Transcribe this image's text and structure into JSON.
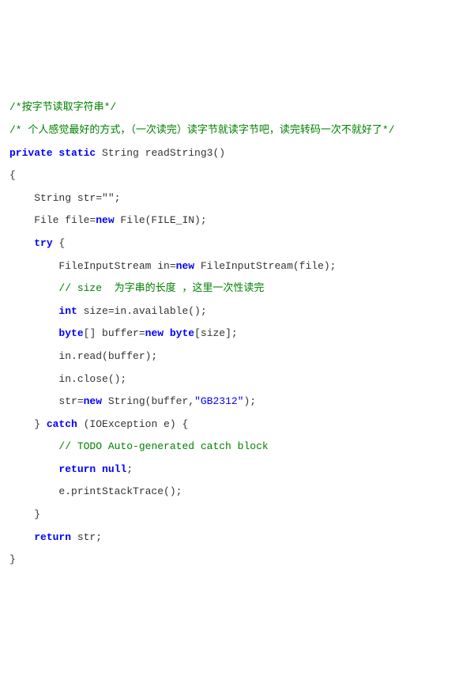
{
  "code": {
    "lines": [
      {
        "type": "comment",
        "text": "/*按字节读取字符串*/"
      },
      {
        "type": "comment",
        "text": "/* 个人感觉最好的方式，（一次读完）读字节就读字节吧，读完转码一次不就好了*/"
      },
      {
        "type": "mixed",
        "segments": [
          {
            "cls": "keyword",
            "t": "private"
          },
          {
            "cls": "plain",
            "t": " "
          },
          {
            "cls": "keyword",
            "t": "static"
          },
          {
            "cls": "plain",
            "t": " String readString3()"
          }
        ]
      },
      {
        "type": "plain",
        "text": "{"
      },
      {
        "type": "plain",
        "text": "    String str=\"\";"
      },
      {
        "type": "mixed",
        "segments": [
          {
            "cls": "plain",
            "t": "    File file="
          },
          {
            "cls": "keyword",
            "t": "new"
          },
          {
            "cls": "plain",
            "t": " File(FILE_IN);"
          }
        ]
      },
      {
        "type": "mixed",
        "segments": [
          {
            "cls": "plain",
            "t": "    "
          },
          {
            "cls": "keyword",
            "t": "try"
          },
          {
            "cls": "plain",
            "t": " {"
          }
        ]
      },
      {
        "type": "mixed",
        "segments": [
          {
            "cls": "plain",
            "t": "        FileInputStream in="
          },
          {
            "cls": "keyword",
            "t": "new"
          },
          {
            "cls": "plain",
            "t": " FileInputStream(file);"
          }
        ]
      },
      {
        "type": "mixed",
        "segments": [
          {
            "cls": "plain",
            "t": "        "
          },
          {
            "cls": "comment",
            "t": "// size  为字串的长度 ，这里一次性读完"
          }
        ]
      },
      {
        "type": "mixed",
        "segments": [
          {
            "cls": "plain",
            "t": "        "
          },
          {
            "cls": "keyword",
            "t": "int"
          },
          {
            "cls": "plain",
            "t": " size=in.available();"
          }
        ]
      },
      {
        "type": "mixed",
        "segments": [
          {
            "cls": "plain",
            "t": "        "
          },
          {
            "cls": "keyword",
            "t": "byte"
          },
          {
            "cls": "plain",
            "t": "[] buffer="
          },
          {
            "cls": "keyword",
            "t": "new"
          },
          {
            "cls": "plain",
            "t": " "
          },
          {
            "cls": "keyword",
            "t": "byte"
          },
          {
            "cls": "plain",
            "t": "[size];"
          }
        ]
      },
      {
        "type": "plain",
        "text": "        in.read(buffer);"
      },
      {
        "type": "plain",
        "text": "        in.close();"
      },
      {
        "type": "mixed",
        "segments": [
          {
            "cls": "plain",
            "t": "        str="
          },
          {
            "cls": "keyword",
            "t": "new"
          },
          {
            "cls": "plain",
            "t": " String(buffer,"
          },
          {
            "cls": "string",
            "t": "\"GB2312\""
          },
          {
            "cls": "plain",
            "t": ");"
          }
        ]
      },
      {
        "type": "mixed",
        "segments": [
          {
            "cls": "plain",
            "t": "    } "
          },
          {
            "cls": "keyword",
            "t": "catch"
          },
          {
            "cls": "plain",
            "t": " (IOException e) {"
          }
        ]
      },
      {
        "type": "mixed",
        "segments": [
          {
            "cls": "plain",
            "t": "        "
          },
          {
            "cls": "comment",
            "t": "// TODO Auto-generated catch block"
          }
        ]
      },
      {
        "type": "mixed",
        "segments": [
          {
            "cls": "plain",
            "t": "        "
          },
          {
            "cls": "keyword",
            "t": "return"
          },
          {
            "cls": "plain",
            "t": " "
          },
          {
            "cls": "keyword",
            "t": "null"
          },
          {
            "cls": "plain",
            "t": ";"
          }
        ]
      },
      {
        "type": "plain",
        "text": "        e.printStackTrace();"
      },
      {
        "type": "plain",
        "text": "    }"
      },
      {
        "type": "mixed",
        "segments": [
          {
            "cls": "plain",
            "t": "    "
          },
          {
            "cls": "keyword",
            "t": "return"
          },
          {
            "cls": "plain",
            "t": " str;"
          }
        ]
      },
      {
        "type": "plain",
        "text": "}"
      }
    ]
  }
}
